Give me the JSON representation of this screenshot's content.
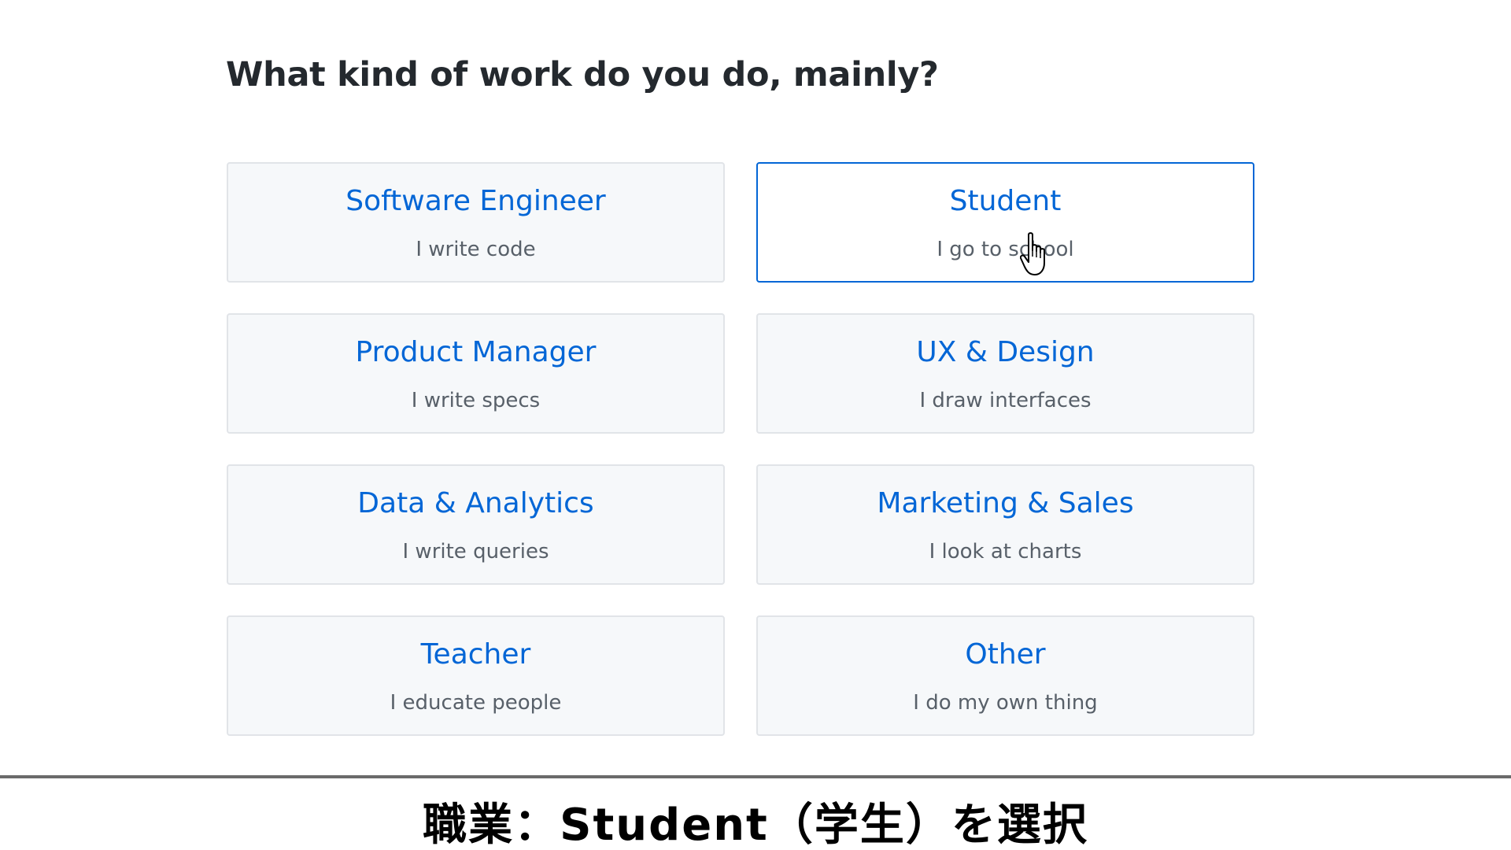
{
  "page": {
    "title": "What kind of work do you do, mainly?"
  },
  "options": [
    {
      "title": "Software Engineer",
      "description": "I write code",
      "selected": false
    },
    {
      "title": "Student",
      "description": "I go to school",
      "selected": true
    },
    {
      "title": "Product Manager",
      "description": "I write specs",
      "selected": false
    },
    {
      "title": "UX & Design",
      "description": "I draw interfaces",
      "selected": false
    },
    {
      "title": "Data & Analytics",
      "description": "I write queries",
      "selected": false
    },
    {
      "title": "Marketing & Sales",
      "description": "I look at charts",
      "selected": false
    },
    {
      "title": "Teacher",
      "description": "I educate people",
      "selected": false
    },
    {
      "title": "Other",
      "description": "I do my own thing",
      "selected": false
    }
  ],
  "caption": {
    "text": "職業：Student（学生）を選択"
  },
  "colors": {
    "accent": "#0366d6",
    "card_background": "#f6f8fa",
    "card_border": "#e1e4e8",
    "title_text": "#24292e",
    "description_text": "#586069"
  },
  "icons": {
    "cursor": "hand-pointer-icon"
  }
}
